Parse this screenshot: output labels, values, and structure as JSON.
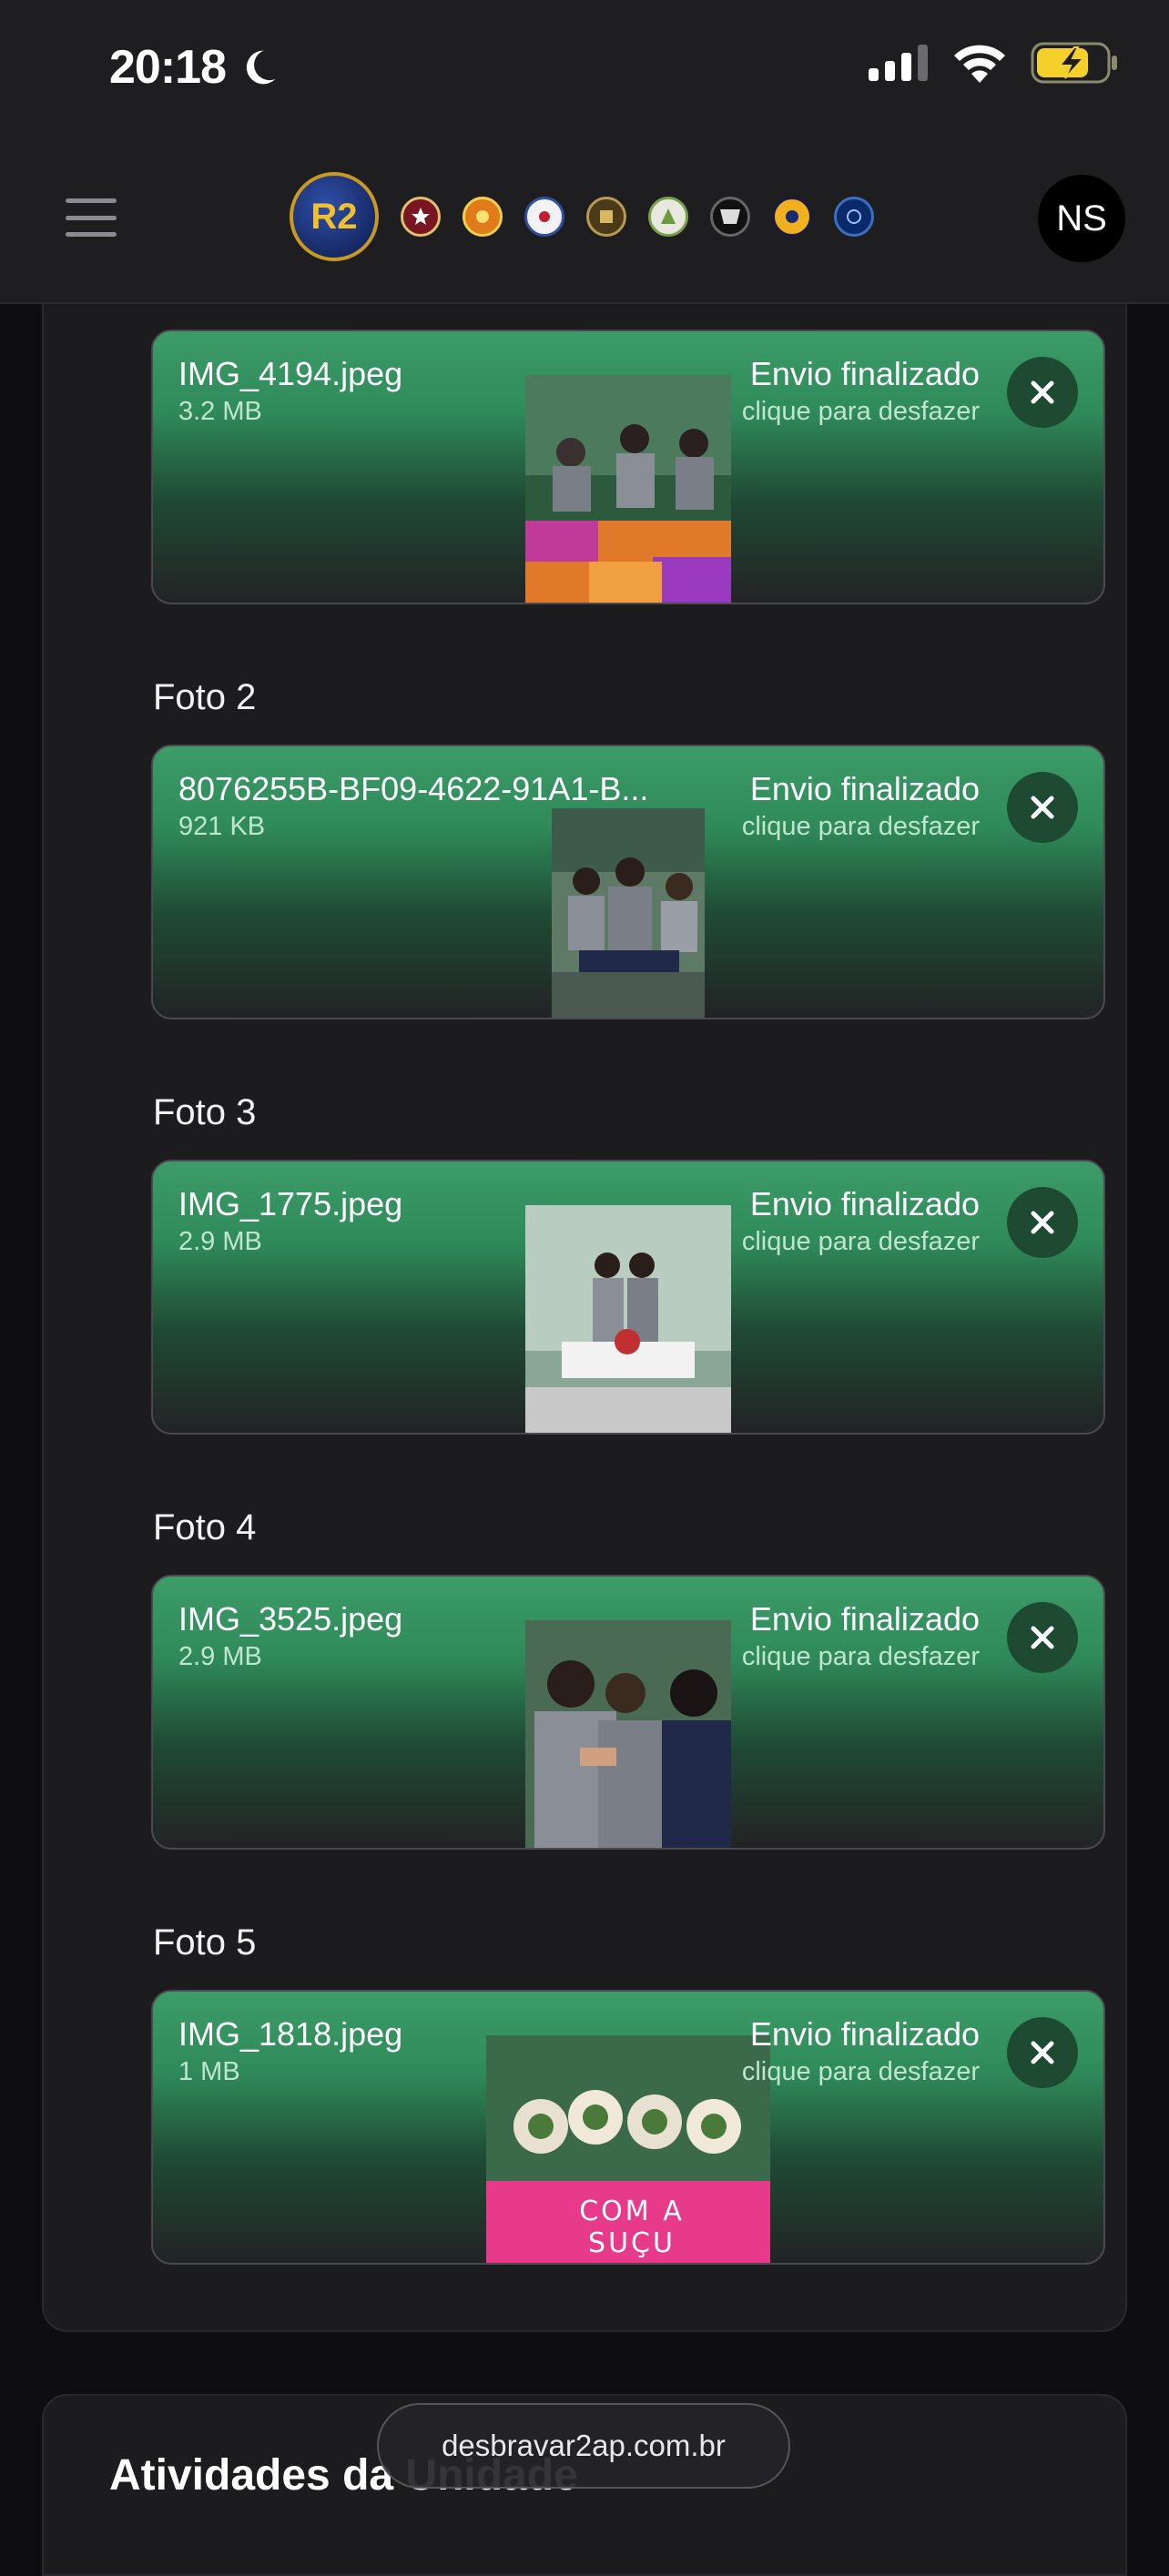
{
  "status_bar": {
    "time": "20:18"
  },
  "header": {
    "avatar_initials": "NS",
    "logo_text": "R2"
  },
  "colors": {
    "card_green": "#3c9c68",
    "background": "#1c1c1f",
    "battery": "#f5d02a"
  },
  "uploads": [
    {
      "label": "",
      "file_name": "IMG_4194.jpeg",
      "file_size": "3.2 MB",
      "status": "Envio finalizado",
      "action": "clique para desfazer"
    },
    {
      "label": "Foto 2",
      "file_name": "8076255B-BF09-4622-91A1-B...",
      "file_size": "921 KB",
      "status": "Envio finalizado",
      "action": "clique para desfazer"
    },
    {
      "label": "Foto 3",
      "file_name": "IMG_1775.jpeg",
      "file_size": "2.9 MB",
      "status": "Envio finalizado",
      "action": "clique para desfazer"
    },
    {
      "label": "Foto 4",
      "file_name": "IMG_3525.jpeg",
      "file_size": "2.9 MB",
      "status": "Envio finalizado",
      "action": "clique para desfazer"
    },
    {
      "label": "Foto 5",
      "file_name": "IMG_1818.jpeg",
      "file_size": "1 MB",
      "status": "Envio finalizado",
      "action": "clique para desfazer"
    }
  ],
  "photo5_caption": "COM A SUÇU",
  "next_section": {
    "title": "Atividades da Unidade"
  },
  "browser": {
    "url": "desbravar2ap.com.br"
  }
}
